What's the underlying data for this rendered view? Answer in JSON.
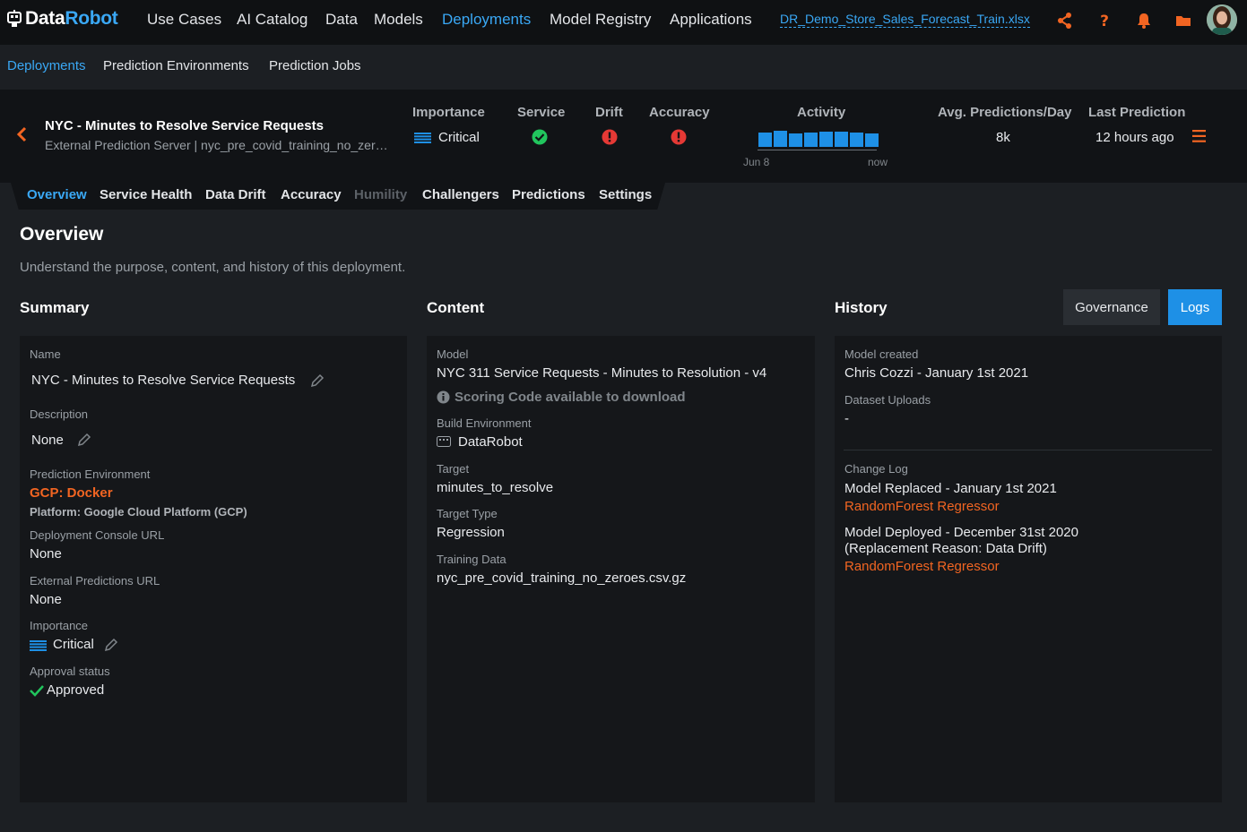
{
  "topnav": {
    "logo_left": "Data",
    "logo_right": "Robot",
    "items": [
      "Use Cases",
      "AI Catalog",
      "Data",
      "Models",
      "Deployments",
      "Model Registry",
      "Applications"
    ],
    "active": "Deployments",
    "file_link": "DR_Demo_Store_Sales_Forecast_Train.xlsx",
    "icons": [
      "share-icon",
      "help-icon",
      "bell-icon",
      "folder-icon",
      "avatar"
    ]
  },
  "subnav": {
    "items": [
      "Deployments",
      "Prediction Environments",
      "Prediction Jobs"
    ],
    "active": "Deployments"
  },
  "deployment": {
    "title": "NYC - Minutes to Resolve Service Requests",
    "subtitle": "External Prediction Server | nyc_pre_covid_training_no_zeroes.csv.gz",
    "importance_label": "Importance",
    "importance_value": "Critical",
    "service_label": "Service",
    "drift_label": "Drift",
    "accuracy_label": "Accuracy",
    "activity_label": "Activity",
    "activity_start": "Jun 8",
    "activity_end": "now",
    "activity_levels": [
      0.85,
      0.95,
      0.8,
      0.85,
      0.9,
      0.9,
      0.85,
      0.8
    ],
    "avg_pred_label": "Avg. Predictions/Day",
    "avg_pred_value": "8k",
    "last_pred_label": "Last Prediction",
    "last_pred_value": "12 hours ago",
    "status_colors": {
      "ok": "#21c55d",
      "error": "#e53935"
    }
  },
  "tabs": {
    "items": [
      "Overview",
      "Service Health",
      "Data Drift",
      "Accuracy",
      "Humility",
      "Challengers",
      "Predictions",
      "Settings"
    ],
    "active": "Overview",
    "disabled": "Humility"
  },
  "page": {
    "title": "Overview",
    "description": "Understand the purpose, content, and history of this deployment."
  },
  "summary": {
    "title": "Summary",
    "name_label": "Name",
    "name_value": "NYC - Minutes to Resolve Service Requests",
    "description_label": "Description",
    "description_value": "None",
    "pred_env_label": "Prediction Environment",
    "pred_env_value": "GCP: Docker",
    "platform": "Platform: Google Cloud Platform (GCP)",
    "console_url_label": "Deployment Console URL",
    "console_url_value": "None",
    "ext_pred_url_label": "External Predictions URL",
    "ext_pred_url_value": "None",
    "importance_label": "Importance",
    "importance_value": "Critical",
    "approval_label": "Approval status",
    "approval_value": "Approved"
  },
  "content": {
    "title": "Content",
    "model_label": "Model",
    "model_value": "NYC 311 Service Requests - Minutes to Resolution - v4",
    "scoring_code": "Scoring Code available to download",
    "build_env_label": "Build Environment",
    "build_env_value": "DataRobot",
    "target_label": "Target",
    "target_value": "minutes_to_resolve",
    "target_type_label": "Target Type",
    "target_type_value": "Regression",
    "training_label": "Training Data",
    "training_value": "nyc_pre_covid_training_no_zeroes.csv.gz"
  },
  "history": {
    "title": "History",
    "governance_button": "Governance",
    "logs_button": "Logs",
    "model_created_label": "Model created",
    "model_created_value": "Chris Cozzi - January 1st 2021",
    "dataset_label": "Dataset Uploads",
    "dataset_value": "-",
    "changelog_label": "Change Log",
    "entry1_title": "Model Replaced - January 1st 2021",
    "entry1_model": "RandomForest Regressor",
    "entry2_title": "Model Deployed - December 31st 2020",
    "entry2_reason": "(Replacement Reason: Data Drift)",
    "entry2_model": "RandomForest Regressor"
  },
  "colors": {
    "accent": "#1e90e6",
    "link": "#3aa8f5",
    "orange": "#f26522"
  }
}
